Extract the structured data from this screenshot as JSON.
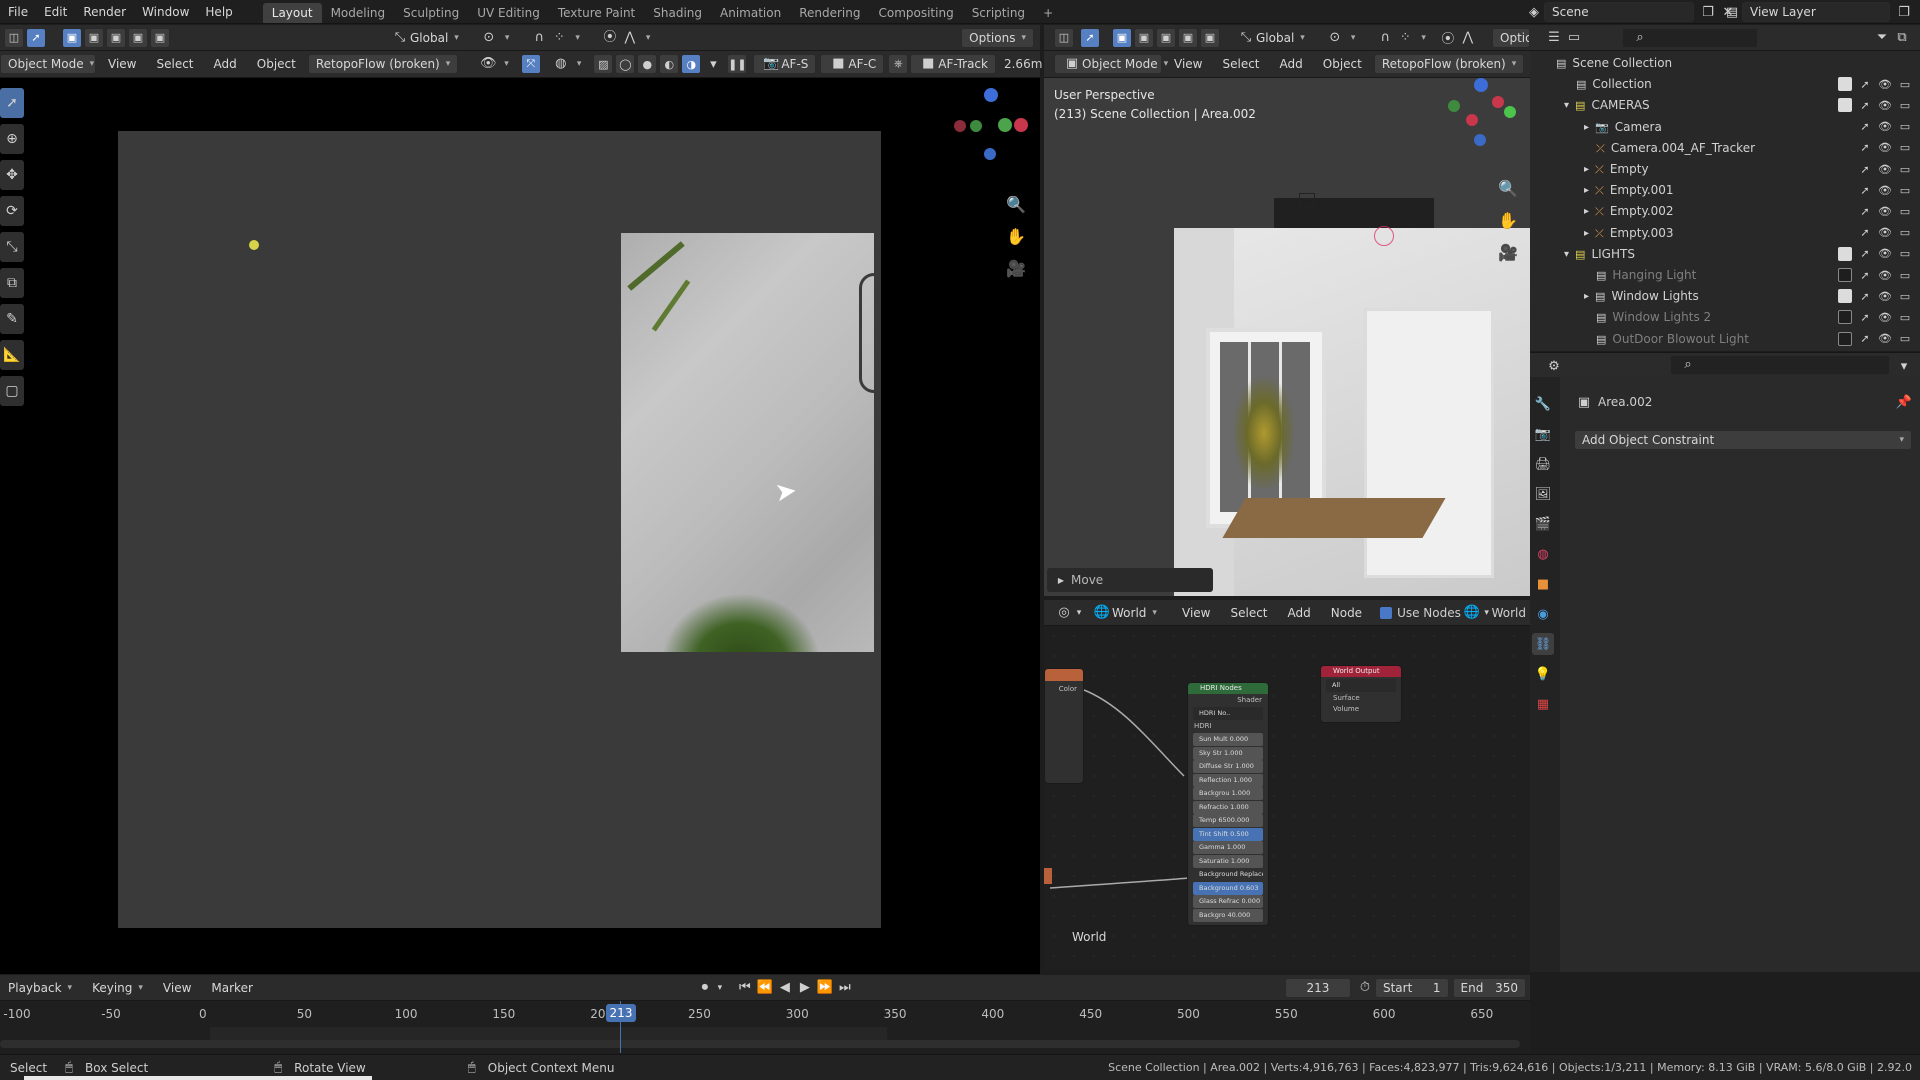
{
  "menu": [
    "File",
    "Edit",
    "Render",
    "Window",
    "Help"
  ],
  "workspaces": [
    "Layout",
    "Modeling",
    "Sculpting",
    "UV Editing",
    "Texture Paint",
    "Shading",
    "Animation",
    "Rendering",
    "Compositing",
    "Scripting"
  ],
  "active_workspace": "Layout",
  "scene": "Scene",
  "view_layer": "View Layer",
  "left_view": {
    "orientation": "Global",
    "options": "Options",
    "mode": "Object Mode",
    "menus": [
      "View",
      "Select",
      "Add",
      "Object"
    ],
    "addon": "RetopoFlow (broken)",
    "af_s": "AF-S",
    "af_c": "AF-C",
    "af_track": "AF-Track",
    "distance": "2.66m"
  },
  "right_view": {
    "orientation": "Global",
    "options": "Optio",
    "mode": "Object Mode",
    "menus": [
      "View",
      "Select",
      "Add",
      "Object"
    ],
    "addon": "RetopoFlow (broken)",
    "perspective": "User Perspective",
    "context": "(213) Scene Collection | Area.002",
    "last_op": "Move"
  },
  "outliner": {
    "search_placeholder": "",
    "rows": [
      {
        "label": "Scene Collection",
        "indent": 0
      },
      {
        "label": "Collection",
        "indent": 1
      },
      {
        "label": "CAMERAS",
        "indent": 1
      },
      {
        "label": "Camera",
        "indent": 2
      },
      {
        "label": "Camera.004_AF_Tracker",
        "indent": 2
      },
      {
        "label": "Empty",
        "indent": 2
      },
      {
        "label": "Empty.001",
        "indent": 2
      },
      {
        "label": "Empty.002",
        "indent": 2
      },
      {
        "label": "Empty.003",
        "indent": 2
      },
      {
        "label": "LIGHTS",
        "indent": 1
      },
      {
        "label": "Hanging Light",
        "indent": 2
      },
      {
        "label": "Window Lights",
        "indent": 2
      },
      {
        "label": "Window Lights 2",
        "indent": 2
      },
      {
        "label": "OutDoor Blowout Light",
        "indent": 2
      }
    ]
  },
  "properties": {
    "object_name": "Area.002",
    "constraint_button": "Add Object Constraint"
  },
  "node_editor": {
    "type": "World",
    "menus": [
      "View",
      "Select",
      "Add",
      "Node"
    ],
    "use_nodes": "Use Nodes",
    "world_right": "World",
    "world_label": "World",
    "color_socket": "Color",
    "hdr_node_title": "HDRI Nodes",
    "shader_socket": "Shader",
    "hdr_select": "HDRI No..",
    "hdr_label": "HDRI",
    "hdr_params": [
      "Sun Mult 0.000",
      "Sky Str 1.000",
      "Diffuse Str 1.000",
      "Reflection 1.000",
      "Backgrou 1.000",
      "Refractio 1.000",
      "Temp 6500.000",
      "Tint Shift 0.500",
      "Gamma 1.000",
      "Saturatio 1.000",
      "Background Replace...",
      "Background 0.603",
      "Glass Refrac 0.000",
      "Backgro 40.000"
    ],
    "output_title": "World Output",
    "output_target": "All",
    "output_sockets": [
      "Surface",
      "Volume"
    ]
  },
  "timeline": {
    "menus": [
      "Playback",
      "Keying",
      "View",
      "Marker"
    ],
    "current_frame": "213",
    "start_label": "Start",
    "start": "1",
    "end_label": "End",
    "end": "350",
    "ticks": [
      "-100",
      "-50",
      "0",
      "50",
      "100",
      "150",
      "200",
      "250",
      "300",
      "350",
      "400",
      "450",
      "500",
      "550",
      "600",
      "650"
    ]
  },
  "status_bar": {
    "select": "Select",
    "box_select": "Box Select",
    "rotate": "Rotate View",
    "context_menu": "Object Context Menu",
    "stats": "Scene Collection | Area.002 | Verts:4,916,763 | Faces:4,823,977 | Tris:9,624,616 | Objects:1/3,211 | Memory: 8.13 GiB | VRAM: 5.6/8.0 GiB | 2.92.0"
  },
  "colors": {
    "accent": "#4a6fa5",
    "frame_marker": "#4772b3",
    "node_output": "#a0233a",
    "node_group": "#2f6b3a"
  }
}
